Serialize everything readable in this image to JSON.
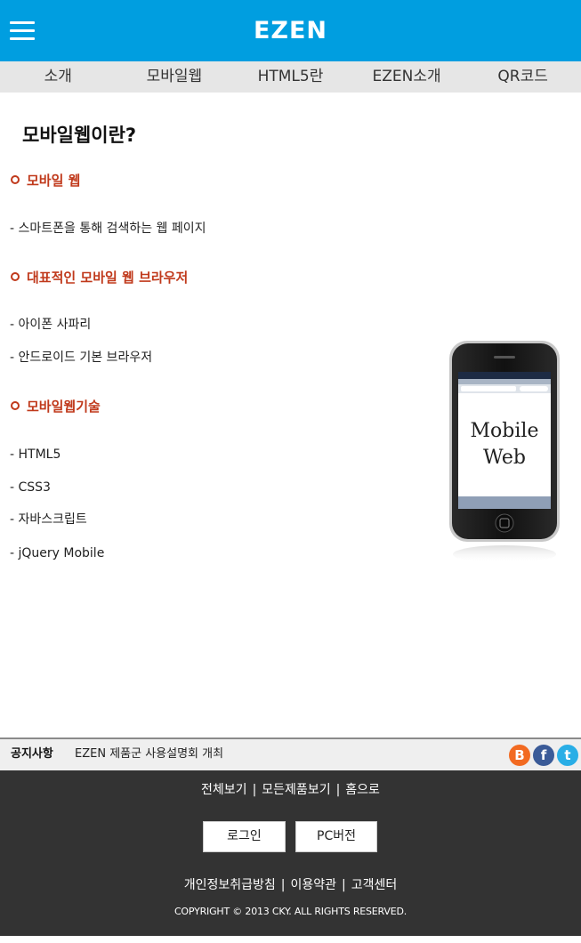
{
  "header": {
    "logo": "EZEN"
  },
  "nav": {
    "items": [
      "소개",
      "모바일웹",
      "HTML5란",
      "EZEN소개",
      "QR코드"
    ]
  },
  "main": {
    "title": "모바일웹이란?",
    "sections": [
      {
        "heading": "모바일 웹",
        "items": [
          "- 스마트폰을 통해 검색하는 웹 페이지"
        ]
      },
      {
        "heading": "대표적인 모바일 웹 브라우저",
        "items": [
          "- 아이폰 사파리",
          "- 안드로이드 기본 브라우저"
        ]
      },
      {
        "heading": "모바일웹기술",
        "items": [
          "- HTML5",
          "- CSS3",
          "- 자바스크립트",
          "- jQuery Mobile"
        ]
      }
    ],
    "phone_image": {
      "line1": "Mobile",
      "line2": "Web"
    }
  },
  "notice": {
    "label": "공지사항",
    "text": "EZEN 제품군 사용설명회 개최"
  },
  "social": {
    "blog": "B",
    "facebook": "f",
    "twitter": "t"
  },
  "footer": {
    "top_links": [
      "전체보기",
      "모든제품보기",
      "홈으로"
    ],
    "separator": "|",
    "login_button": "로그인",
    "pc_button": "PC버전",
    "bottom_links": [
      "개인정보취급방침",
      "이용약관",
      "고객센터"
    ],
    "copyright": "COPYRIGHT © 2013 CKY. ALL RIGHTS RESERVED."
  },
  "colors": {
    "header_bg": "#009ee0",
    "accent_red": "#c0391b",
    "footer_bg": "#333333",
    "nav_bg": "#e6e6e6"
  }
}
